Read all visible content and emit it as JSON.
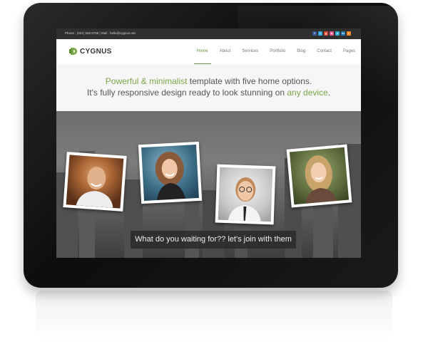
{
  "topbar": {
    "contact": "Phone : (021) 555 6789  |  Mail : hello@cygnus.net",
    "socials": [
      {
        "icon": "facebook-icon",
        "glyph": "f",
        "color": "#3b5998"
      },
      {
        "icon": "twitter-icon",
        "glyph": "t",
        "color": "#33a6d8"
      },
      {
        "icon": "google-plus-icon",
        "glyph": "g",
        "color": "#d6492f"
      },
      {
        "icon": "dribbble-icon",
        "glyph": "d",
        "color": "#e05a8c"
      },
      {
        "icon": "vimeo-icon",
        "glyph": "v",
        "color": "#37aad4"
      },
      {
        "icon": "linkedin-icon",
        "glyph": "in",
        "color": "#1c7bb3"
      },
      {
        "icon": "rss-icon",
        "glyph": "r",
        "color": "#ee8a2a"
      }
    ]
  },
  "header": {
    "brand": "CYGNUS",
    "brand_color": "#7aa64a",
    "nav": [
      "Home",
      "About",
      "Services",
      "Portfolio",
      "Blog",
      "Contact",
      "Pages"
    ],
    "active": "Home"
  },
  "hero": {
    "line1_highlight": "Powerful & minimalist",
    "line1_rest": " template with five home options.",
    "line2_start": "It's fully responsive design ready to look stunning on ",
    "line2_highlight": "any device",
    "line2_end": "."
  },
  "banner": {
    "caption": "What do you waiting for?? let's join with them"
  }
}
